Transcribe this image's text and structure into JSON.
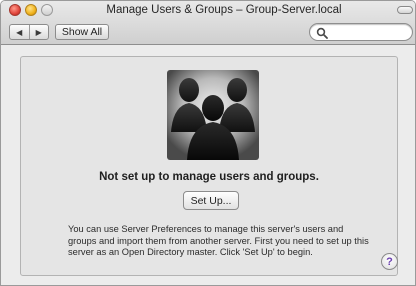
{
  "window": {
    "title": "Manage Users & Groups – Group-Server.local"
  },
  "toolbar": {
    "back_icon": "back-arrow-icon",
    "forward_icon": "forward-arrow-icon",
    "back_glyph": "◀",
    "forward_glyph": "▶",
    "show_all_label": "Show All",
    "search": {
      "placeholder": "",
      "value": ""
    }
  },
  "content": {
    "illustration_icon": "users-group-icon",
    "heading": "Not set up to manage users and groups.",
    "setup_button_label": "Set Up...",
    "description": "You can use Server Preferences to manage this server's users and groups and import them from another server. First you need to set up this server as an Open Directory master. Click 'Set Up' to begin.",
    "help_label": "?"
  },
  "colors": {
    "help_glyph": "#6b3fb0",
    "panel_bg": "#e5e5e5",
    "window_bg": "#ececec"
  }
}
